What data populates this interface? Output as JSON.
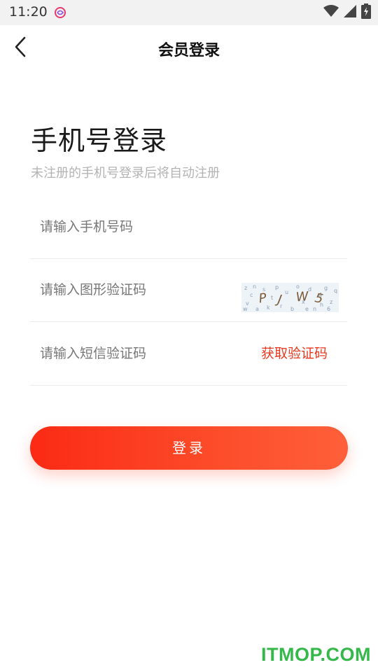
{
  "status_bar": {
    "time": "11:20",
    "icons": [
      "app-notification-icon",
      "wifi-icon",
      "signal-icon",
      "battery-charging-icon"
    ]
  },
  "header": {
    "back_icon": "chevron-left-icon",
    "title": "会员登录"
  },
  "main": {
    "title": "手机号登录",
    "subtitle": "未注册的手机号登录后将自动注册",
    "phone_input": {
      "value": "",
      "placeholder": "请输入手机号码"
    },
    "captcha_input": {
      "value": "",
      "placeholder": "请输入图形验证码"
    },
    "captcha_image": {
      "text": "PJW5"
    },
    "sms_input": {
      "value": "",
      "placeholder": "请输入短信验证码"
    },
    "get_code_label": "获取验证码",
    "login_label": "登录"
  },
  "watermark": "ITMOP.COM",
  "colors": {
    "accent": "#e8381e",
    "button_gradient_start": "#fb2a14",
    "button_gradient_end": "#fe5f3a",
    "watermark": "#35b84a"
  }
}
